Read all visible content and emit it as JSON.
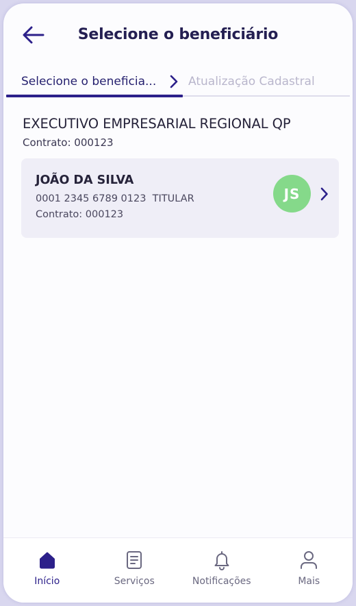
{
  "header": {
    "title": "Selecione o beneficiário",
    "back_icon": "arrow-left-icon"
  },
  "stepper": {
    "steps": [
      {
        "label": "Selecione o beneficia...",
        "active": true
      },
      {
        "label": "Atualização Cadastral",
        "active": false
      }
    ]
  },
  "company": {
    "name": "EXECUTIVO EMPRESARIAL REGIONAL QP",
    "contract": "Contrato: 000123"
  },
  "beneficiaries": [
    {
      "name": "JOÃO DA SILVA",
      "card_line": "0001 2345 6789 0123  TITULAR",
      "contract": "Contrato: 000123",
      "initials": "JS"
    }
  ],
  "bottom_nav": {
    "items": [
      {
        "label": "Início",
        "icon": "home-icon",
        "active": true
      },
      {
        "label": "Serviços",
        "icon": "document-icon",
        "active": false
      },
      {
        "label": "Notificações",
        "icon": "bell-icon",
        "active": false
      },
      {
        "label": "Mais",
        "icon": "user-icon",
        "active": false
      }
    ]
  },
  "colors": {
    "primary": "#2c208a",
    "title": "#241f52",
    "avatar": "#85d98a",
    "card_bg": "#efeef7",
    "inactive_step": "#b9b6cc"
  }
}
